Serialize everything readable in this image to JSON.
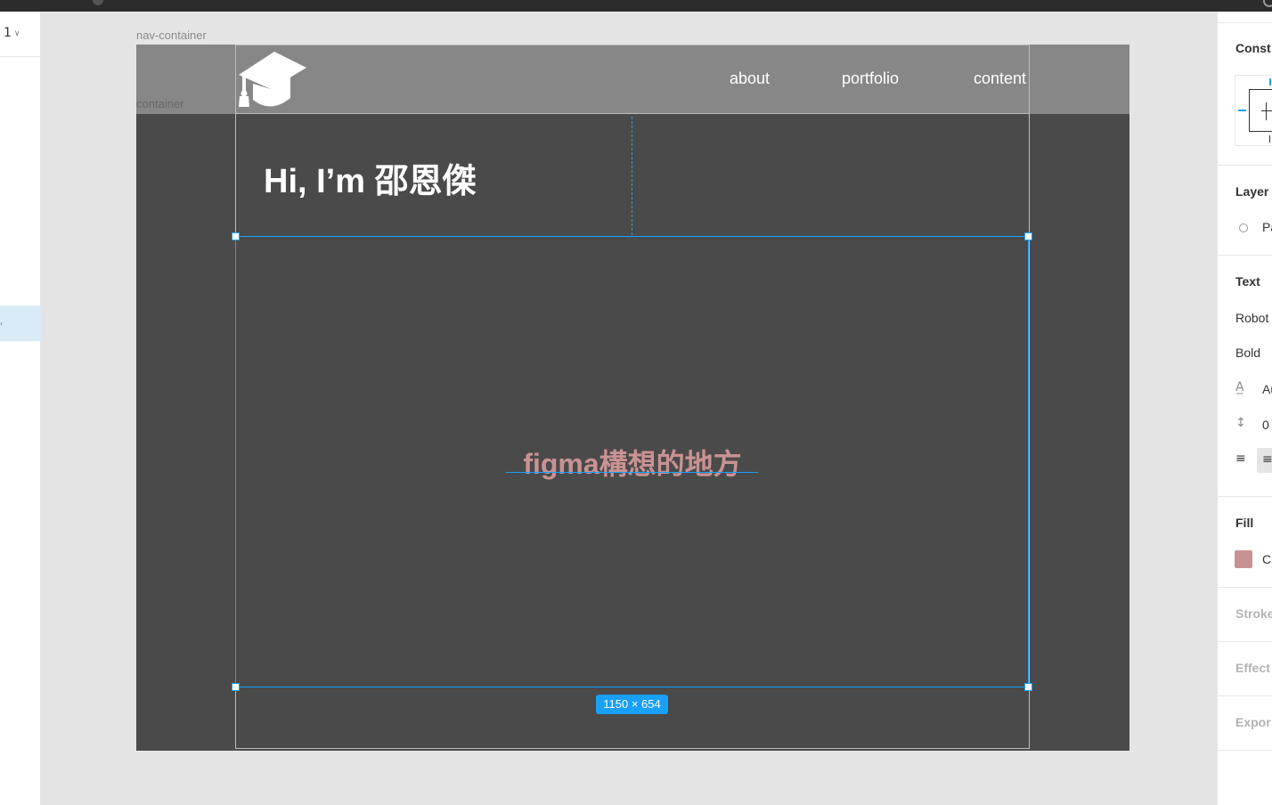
{
  "app": {
    "page_selector": "1"
  },
  "canvas": {
    "frame_labels": {
      "nav_container": "nav-container",
      "container": "container"
    },
    "nav": {
      "links": [
        "about",
        "portfolio",
        "content"
      ]
    },
    "hero": {
      "greeting": "Hi, I’m  邵恩傑"
    },
    "selected_text": "figma構想的地方",
    "dimensions_badge": "1150 × 654",
    "colors": {
      "frame_bg": "#4a4a4a",
      "nav_bg": "#878787",
      "selection": "#18a0fb",
      "text_fill": "#c99292"
    }
  },
  "properties": {
    "constraints_title": "Const",
    "layer_title": "Layer",
    "layer_value": "Pa",
    "text_title": "Text",
    "font_family": "Robot",
    "font_weight": "Bold",
    "letter_value": "Au",
    "line_height_value": "0",
    "fill_title": "Fill",
    "fill_value": "C",
    "stroke_title": "Stroke",
    "effects_title": "Effect",
    "export_title": "Expor"
  }
}
